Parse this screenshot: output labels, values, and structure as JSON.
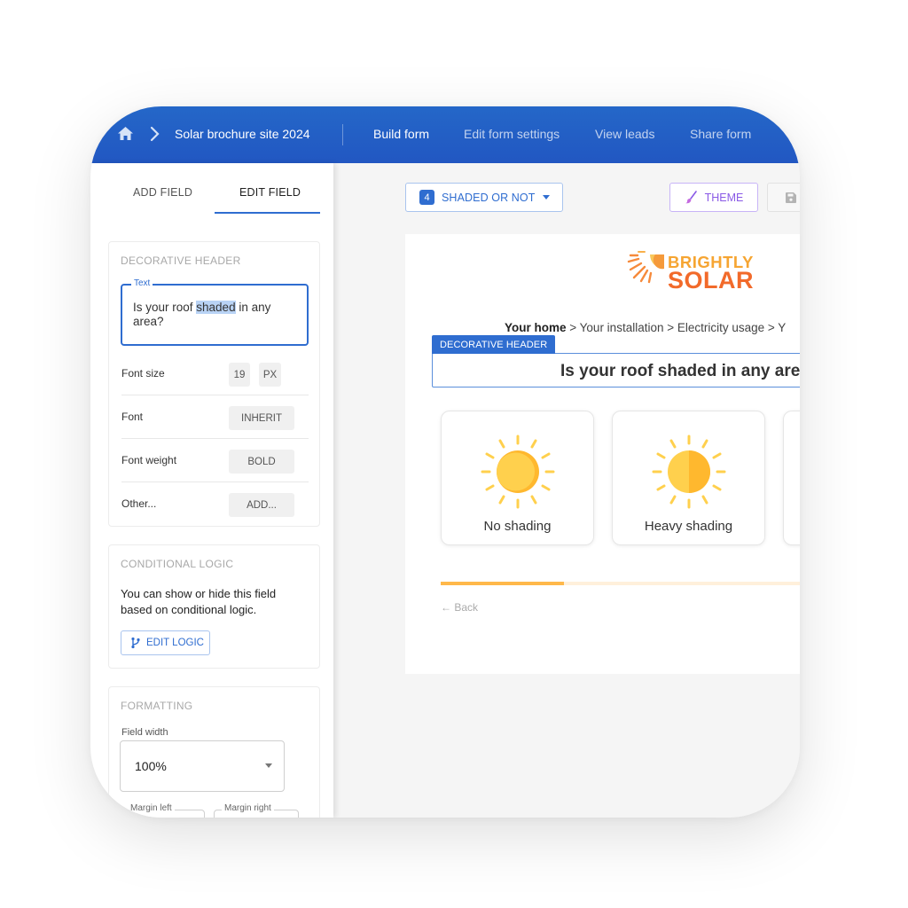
{
  "topbar": {
    "breadcrumb": "Solar brochure site 2024",
    "nav": [
      {
        "label": "Build form",
        "active": true
      },
      {
        "label": "Edit form settings",
        "active": false
      },
      {
        "label": "View leads",
        "active": false
      },
      {
        "label": "Share form",
        "active": false
      }
    ],
    "icons": {
      "home": "home-icon",
      "separator": "chevron-right-icon"
    }
  },
  "left_panel": {
    "tabs": [
      {
        "label": "ADD FIELD",
        "active": false
      },
      {
        "label": "EDIT FIELD",
        "active": true
      }
    ],
    "decorative_header": {
      "title": "DECORATIVE HEADER",
      "text_field_label": "Text",
      "text_value_before": "Is your roof ",
      "text_value_highlight": "shaded",
      "text_value_after": " in any area?",
      "properties": [
        {
          "label": "Font size",
          "value": "19",
          "unit": "PX"
        },
        {
          "label": "Font",
          "value": "INHERIT"
        },
        {
          "label": "Font weight",
          "value": "BOLD"
        },
        {
          "label": "Other...",
          "value": "ADD..."
        }
      ]
    },
    "conditional_logic": {
      "title": "CONDITIONAL LOGIC",
      "description": "You can show or hide this field based on conditional logic.",
      "button": "EDIT LOGIC"
    },
    "formatting": {
      "title": "FORMATTING",
      "field_width_label": "Field width",
      "field_width_value": "100%",
      "margin_left_label": "Margin left",
      "margin_right_label": "Margin right"
    }
  },
  "main": {
    "step_selector": {
      "number": "4",
      "label": "SHADED OR NOT"
    },
    "theme_button": "THEME",
    "save_icon": "save-icon",
    "form": {
      "logo": {
        "line1": "BRIGHTLY",
        "line2": "SOLAR"
      },
      "progress_crumbs": {
        "current": "Your home",
        "rest": " > Your installation > Electricity usage > Y"
      },
      "decorative_tag": "DECORATIVE HEADER",
      "header_text": "Is your roof shaded in any area?",
      "choices": [
        {
          "label": "No shading",
          "icon": "sun-icon"
        },
        {
          "label": "Heavy shading",
          "icon": "half-shaded-sun-icon"
        },
        {
          "label": "",
          "icon": ""
        }
      ],
      "progress_fraction": 0.33,
      "back_label": "← Back"
    }
  },
  "colors": {
    "brand_blue": "#2f6dd0",
    "nav_blue": "#2257c2",
    "theme_purple": "#8a5ae6",
    "progress_orange": "#ffb84a",
    "logo_orange": "#f26a2a",
    "logo_yellow": "#f6a532",
    "sun_yellow": "#ffd04d",
    "sun_shade": "#ffb82e"
  }
}
